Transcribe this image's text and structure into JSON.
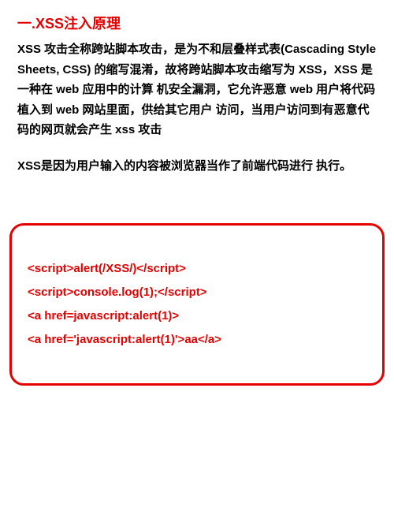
{
  "heading": "一.XSS注入原理",
  "paragraph": "XSS 攻击全称跨站脚本攻击，是为不和层叠样式表(Cascading Style Sheets, CSS) 的缩写混淆，故将跨站脚本攻击缩写为 XSS，XSS 是一种在 web 应用中的计算 机安全漏洞，它允许恶意 web 用户将代码植入到 web 网站里面，供给其它用户 访问，当用户访问到有恶意代码的网页就会产生 xss 攻击",
  "summary": "XSS是因为用户输入的内容被浏览器当作了前端代码进行 执行。",
  "code": {
    "line1": "<script>alert(/XSS/)</script>",
    "line2": "<script>console.log(1);</script>",
    "line3": "<a href=javascript:alert(1)>",
    "line4": "<a href='javascript:alert(1)'>aa</a>"
  }
}
